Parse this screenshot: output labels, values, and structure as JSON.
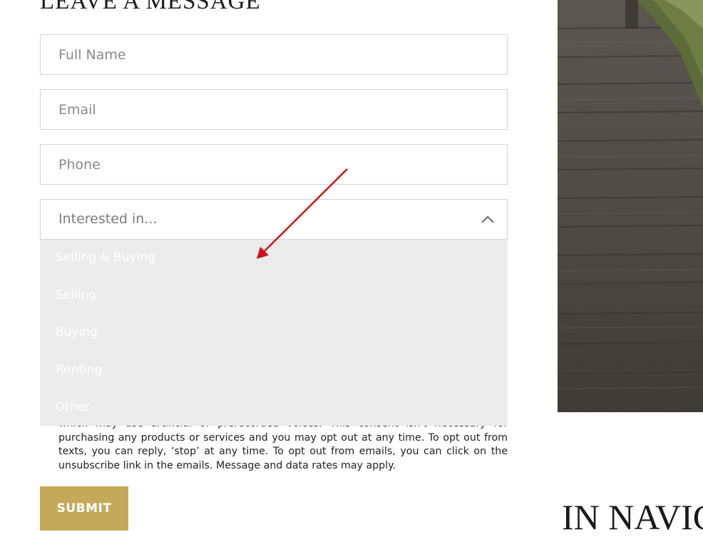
{
  "form": {
    "heading": "LEAVE A MESSAGE",
    "full_name_placeholder": "Full Name",
    "email_placeholder": "Email",
    "phone_placeholder": "Phone",
    "interest_select": {
      "value": "Interested in...",
      "icon": "chevron-up-icon",
      "options": [
        "Selling & Buying",
        "Selling",
        "Buying",
        "Renting",
        "Other"
      ]
    },
    "consent_text": "which may use artificial or prerecorded voices. This consent isn't necessary for purchasing any products or services and you may opt out at any time. To opt out from texts, you can reply, ‘stop’ at any time. To opt out from emails, you can click on the unsubscribe link in the emails. Message and data rates may apply.",
    "submit_label": "SUBMIT"
  },
  "side": {
    "heading": "IN NAVIG"
  },
  "colors": {
    "accent": "#c5a95a",
    "dropdown_bg": "#ececec",
    "annotation_arrow": "#d0121a"
  }
}
